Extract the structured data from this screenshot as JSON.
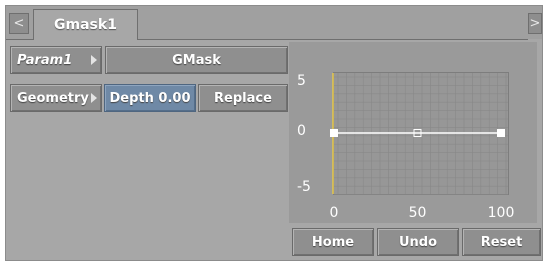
{
  "tabs": {
    "prev_label": "<",
    "next_label": ">",
    "active_tab": "Gmask1"
  },
  "controls": {
    "param_menu": "Param1",
    "gmask_label": "GMask",
    "geometry_menu": "Geometry",
    "depth_field": "Depth 0.00",
    "replace_button": "Replace"
  },
  "chart_data": {
    "type": "line",
    "y_ticks": [
      "5",
      "0",
      "-5"
    ],
    "x_ticks": [
      "0",
      "50",
      "100"
    ],
    "xlim": [
      0,
      100
    ],
    "ylim": [
      -5,
      5
    ],
    "grid": true,
    "series": [
      {
        "x": [
          0,
          50,
          100
        ],
        "y": [
          0,
          0,
          0
        ],
        "color": "#ffffff"
      }
    ],
    "keyframe_styles": [
      "filled",
      "hollow",
      "filled"
    ],
    "cursor": {
      "x": 0,
      "color": "#e8c94a"
    }
  },
  "footer": {
    "home_button": "Home",
    "undo_button": "Undo",
    "reset_button": "Reset"
  }
}
